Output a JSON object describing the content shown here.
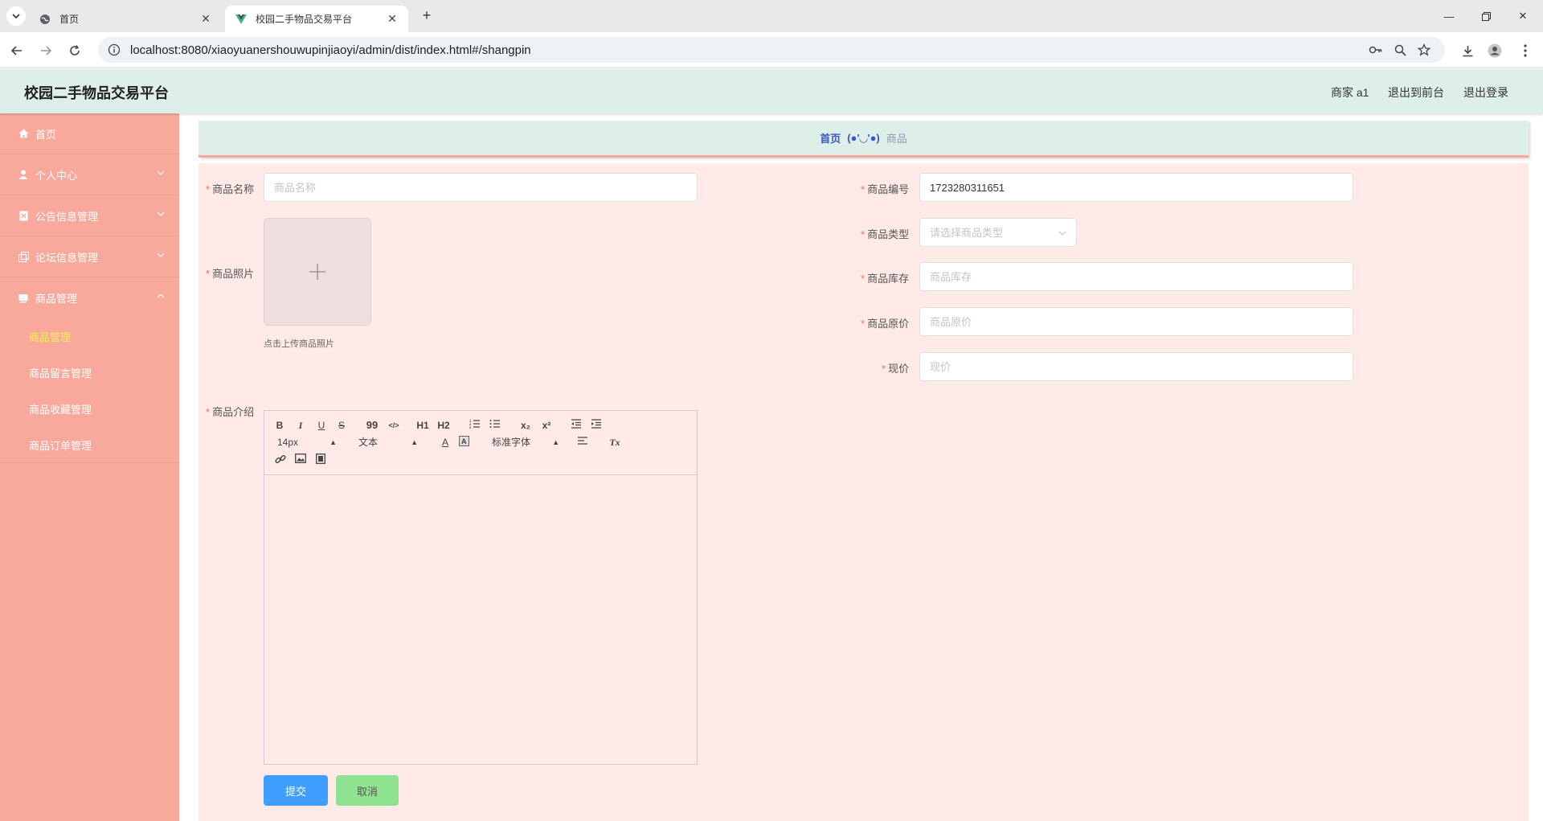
{
  "browser": {
    "tabs": [
      {
        "title": "首页",
        "active": false
      },
      {
        "title": "校园二手物品交易平台",
        "active": true
      }
    ],
    "url": "localhost:8080/xiaoyuanershouwupinjiaoyi/admin/dist/index.html#/shangpin",
    "new_tab": "+"
  },
  "header": {
    "title": "校园二手物品交易平台",
    "user": "商家 a1",
    "back_front": "退出到前台",
    "logout": "退出登录"
  },
  "sidebar": {
    "items": [
      {
        "label": "首页",
        "icon": "home-icon"
      },
      {
        "label": "个人中心",
        "icon": "user-icon"
      },
      {
        "label": "公告信息管理",
        "icon": "notice-icon"
      },
      {
        "label": "论坛信息管理",
        "icon": "forum-icon"
      },
      {
        "label": "商品管理",
        "icon": "goods-icon"
      }
    ],
    "sub_items": [
      {
        "label": "商品管理",
        "active": true
      },
      {
        "label": "商品留言管理",
        "active": false
      },
      {
        "label": "商品收藏管理",
        "active": false
      },
      {
        "label": "商品订单管理",
        "active": false
      }
    ]
  },
  "breadcrumb": {
    "home": "首页",
    "separator": "(●'◡'●)",
    "current": "商品"
  },
  "form": {
    "required_mark": "*",
    "name": {
      "label": "商品名称",
      "placeholder": "商品名称",
      "value": ""
    },
    "photo": {
      "label": "商品照片",
      "hint": "点击上传商品照片"
    },
    "intro": {
      "label": "商品介绍"
    },
    "code": {
      "label": "商品编号",
      "value": "1723280311651"
    },
    "type": {
      "label": "商品类型",
      "placeholder": "请选择商品类型"
    },
    "stock": {
      "label": "商品库存",
      "placeholder": "商品库存"
    },
    "orig_price": {
      "label": "商品原价",
      "placeholder": "商品原价"
    },
    "price": {
      "label": "现价",
      "placeholder": "现价"
    }
  },
  "editor": {
    "font_size": "14px",
    "header": "文本",
    "font_family": "标准字体",
    "buttons": {
      "bold": "B",
      "italic": "I",
      "underline": "U",
      "strike": "S",
      "quote": "99",
      "code": "</>",
      "h1": "H1",
      "h2": "H2",
      "sub": "x₂",
      "sup": "x²",
      "clean": "Tx",
      "bg": "A"
    }
  },
  "actions": {
    "submit": "提交",
    "cancel": "取消"
  },
  "colors": {
    "sidebar": "#f9a99b",
    "header": "#deeee8",
    "form_bg": "#ffeae7",
    "submit": "#409eff",
    "cancel": "#8fe28f",
    "active_sub": "#f8f155"
  }
}
